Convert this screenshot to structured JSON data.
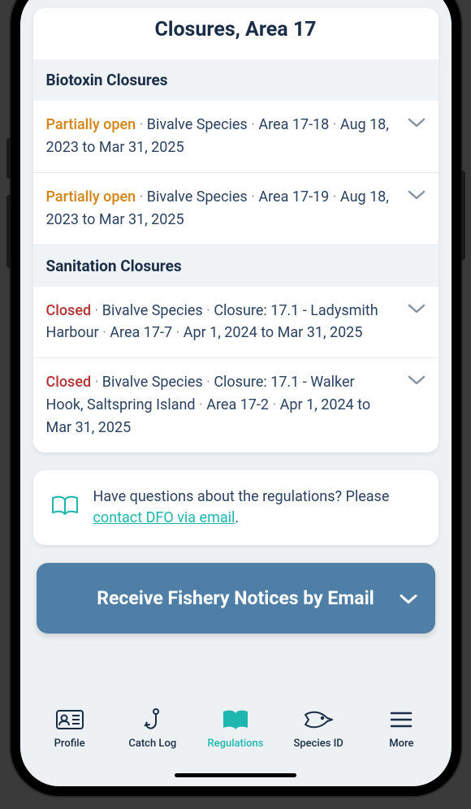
{
  "page_title": "Closures, Area 17",
  "colors": {
    "accent": "#1db7b0",
    "primary_text": "#1a2d47",
    "cta_bg": "#4f7fa6",
    "status_partial": "#d48315",
    "status_closed": "#b43433"
  },
  "sections": [
    {
      "key": "biotoxin",
      "title": "Biotoxin Closures",
      "items": [
        {
          "status": "Partially open",
          "status_class": "status-partial",
          "species": "Bivalve Species",
          "area": "Area 17-18",
          "dates": "Aug 18, 2023 to Mar 31, 2025"
        },
        {
          "status": "Partially open",
          "status_class": "status-partial",
          "species": "Bivalve Species",
          "area": "Area 17-19",
          "dates": "Aug 18, 2023 to Mar 31, 2025"
        }
      ]
    },
    {
      "key": "sanitation",
      "title": "Sanitation Closures",
      "items": [
        {
          "status": "Closed",
          "status_class": "status-closed",
          "species": "Bivalve Species",
          "closure": "Closure: 17.1 - Ladysmith Harbour",
          "area": "Area 17-7",
          "dates": "Apr 1, 2024 to Mar 31, 2025"
        },
        {
          "status": "Closed",
          "status_class": "status-closed",
          "species": "Bivalve Species",
          "closure": "Closure: 17.1 - Walker Hook, Saltspring Island",
          "area": "Area 17-2",
          "dates": "Apr 1, 2024 to Mar 31, 2025"
        }
      ]
    }
  ],
  "info_box": {
    "lead": "Have questions about the regulations? Please ",
    "link": "contact DFO via email",
    "trail": "."
  },
  "cta": {
    "label": "Receive Fishery Notices by Email"
  },
  "nav": [
    {
      "label": "Profile",
      "icon": "profile",
      "active": false
    },
    {
      "label": "Catch Log",
      "icon": "hook",
      "active": false
    },
    {
      "label": "Regulations",
      "icon": "book",
      "active": true
    },
    {
      "label": "Species ID",
      "icon": "fish",
      "active": false
    },
    {
      "label": "More",
      "icon": "menu",
      "active": false
    }
  ]
}
